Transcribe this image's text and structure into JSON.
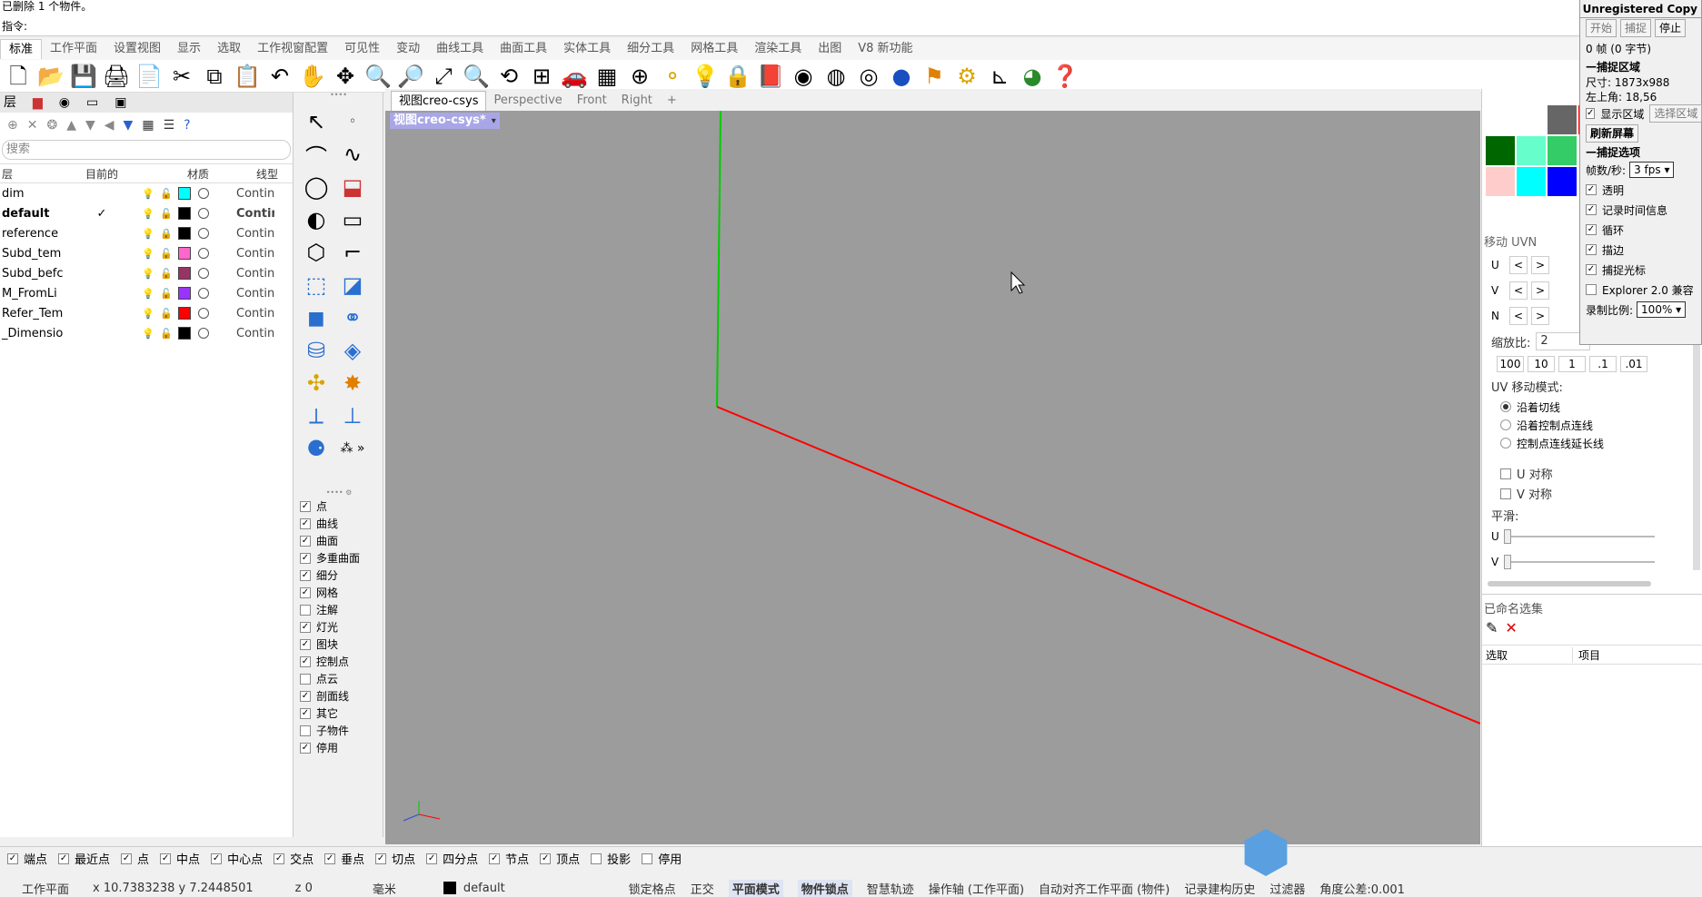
{
  "command_history": "已删除 1 个物件。",
  "command_prompt": "指令:",
  "menu_tabs": [
    "标准",
    "工作平面",
    "设置视图",
    "显示",
    "选取",
    "工作视窗配置",
    "可见性",
    "变动",
    "曲线工具",
    "曲面工具",
    "实体工具",
    "细分工具",
    "网格工具",
    "渲染工具",
    "出图",
    "V8 新功能"
  ],
  "active_menu_tab": "标准",
  "toolbar_icons": [
    "new-file-icon",
    "open-file-icon",
    "save-icon",
    "print-icon",
    "import-icon",
    "cut-icon",
    "copy-icon",
    "paste-icon",
    "undo-icon",
    "pan-hand-icon",
    "rotate-view-icon",
    "zoom-icon",
    "zoom-window-icon",
    "zoom-extents-icon",
    "zoom-selected-icon",
    "rotate-camera-icon",
    "four-viewports-icon",
    "car-render-icon",
    "grid-plane-icon",
    "cplane-icon",
    "snap-point-icon",
    "light-bulb-icon",
    "lock-icon",
    "layer-book-icon",
    "color-wheel-icon",
    "wireframe-sphere-icon",
    "ghosted-sphere-icon",
    "render-sphere-icon",
    "flag-icon",
    "gear-icon",
    "dimension-icon",
    "globe-icon",
    "help-icon"
  ],
  "layers_panel": {
    "title": "层",
    "search_placeholder": "搜索",
    "columns": [
      "层",
      "目前的",
      "材质",
      "线型"
    ],
    "rows": [
      {
        "name": "dim",
        "current": "",
        "color": "#00ffff",
        "locked": false,
        "linetype": "Continuous"
      },
      {
        "name": "default",
        "current": "✓",
        "color": "#000000",
        "locked": false,
        "linetype": "Continuous",
        "bold": true
      },
      {
        "name": "reference",
        "current": "",
        "color": "#000000",
        "locked": true,
        "linetype": "Continuous"
      },
      {
        "name": "Subd_tem",
        "current": "",
        "color": "#ff66cc",
        "locked": false,
        "linetype": "Continuous"
      },
      {
        "name": "Subd_befc",
        "current": "",
        "color": "#993366",
        "locked": false,
        "linetype": "Continuous"
      },
      {
        "name": "M_FromLi",
        "current": "",
        "color": "#9933ff",
        "locked": false,
        "linetype": "Continuous"
      },
      {
        "name": "Refer_Tem",
        "current": "",
        "color": "#ff0000",
        "locked": false,
        "linetype": "Continuous"
      },
      {
        "name": "_Dimensio",
        "current": "",
        "color": "#000000",
        "locked": false,
        "linetype": "Continuous"
      }
    ]
  },
  "object_filters": [
    {
      "label": "点",
      "checked": true
    },
    {
      "label": "曲线",
      "checked": true
    },
    {
      "label": "曲面",
      "checked": true
    },
    {
      "label": "多重曲面",
      "checked": true
    },
    {
      "label": "细分",
      "checked": true
    },
    {
      "label": "网格",
      "checked": true
    },
    {
      "label": "注解",
      "checked": false
    },
    {
      "label": "灯光",
      "checked": true
    },
    {
      "label": "图块",
      "checked": true
    },
    {
      "label": "控制点",
      "checked": true
    },
    {
      "label": "点云",
      "checked": false
    },
    {
      "label": "剖面线",
      "checked": true
    },
    {
      "label": "其它",
      "checked": true
    },
    {
      "label": "子物件",
      "checked": false
    },
    {
      "label": "停用",
      "checked": true
    }
  ],
  "viewport_tabs": [
    "视图creo-csys",
    "Perspective",
    "Front",
    "Right"
  ],
  "active_viewport_tab": "视图creo-csys",
  "viewport_label": "视图creo-csys*",
  "right_panel": {
    "move_uvn_title": "移动 UVN",
    "uvn_rows": [
      "U",
      "V",
      "N"
    ],
    "scale_label": "缩放比:",
    "scale_value": "2",
    "scale_buttons": [
      "100",
      "10",
      "1",
      ".1",
      ".01"
    ],
    "uv_mode_title": "UV 移动模式:",
    "uv_modes": [
      {
        "label": "沿着切线",
        "selected": true
      },
      {
        "label": "沿着控制点连线",
        "selected": false
      },
      {
        "label": "控制点连线延长线",
        "selected": false
      }
    ],
    "sym_u": "U 对称",
    "sym_v": "V 对称",
    "smooth_label": "平滑:",
    "smooth_u": "U",
    "smooth_v": "V",
    "named_sel_title": "已命名选集",
    "named_cols": [
      "选取",
      "项目"
    ]
  },
  "capture_window": {
    "title": "Unregistered Copy",
    "btn_start": "开始",
    "btn_capture": "捕捉",
    "btn_stop": "停止",
    "frames": "0 帧 (0 字节)",
    "region_title": "捕捉区域",
    "size": "尺寸: 1873x988",
    "topleft": "左上角: 18,56",
    "show_region": "显示区域",
    "select_region": "选择区域",
    "refresh": "刷新屏幕",
    "options_title": "捕捉选项",
    "fps_label": "帧数/秒:",
    "fps_value": "3 fps",
    "opt_transparent": "透明",
    "opt_timeinfo": "记录时间信息",
    "opt_loop": "循环",
    "opt_border": "描边",
    "opt_cursor": "捕捉光标",
    "opt_explorer": "Explorer 2.0 兼容",
    "scale_label": "录制比例:",
    "scale_value": "100%"
  },
  "osnaps": [
    {
      "label": "端点",
      "checked": true
    },
    {
      "label": "最近点",
      "checked": true
    },
    {
      "label": "点",
      "checked": true
    },
    {
      "label": "中点",
      "checked": true
    },
    {
      "label": "中心点",
      "checked": true
    },
    {
      "label": "交点",
      "checked": true
    },
    {
      "label": "垂点",
      "checked": true
    },
    {
      "label": "切点",
      "checked": true
    },
    {
      "label": "四分点",
      "checked": true
    },
    {
      "label": "节点",
      "checked": true
    },
    {
      "label": "顶点",
      "checked": true
    },
    {
      "label": "投影",
      "checked": false
    },
    {
      "label": "停用",
      "checked": false
    }
  ],
  "status": {
    "cplane": "工作平面",
    "coords": "x 10.7383238  y 7.2448501",
    "z": "z 0",
    "units": "毫米",
    "layer": "default",
    "items": [
      "锁定格点",
      "正交",
      "平面模式",
      "物件锁点",
      "智慧轨迹",
      "操作轴 (工作平面)",
      "自动对齐工作平面 (物件)",
      "记录建构历史",
      "过滤器",
      "角度公差:0.001"
    ],
    "active_items": [
      "平面模式",
      "物件锁点"
    ]
  },
  "colors": {
    "viewport_bg": "#9c9c9c",
    "x_axis": "#ff0000",
    "y_axis": "#00cc00",
    "viewport_label_bg": "#a9a6e8"
  }
}
